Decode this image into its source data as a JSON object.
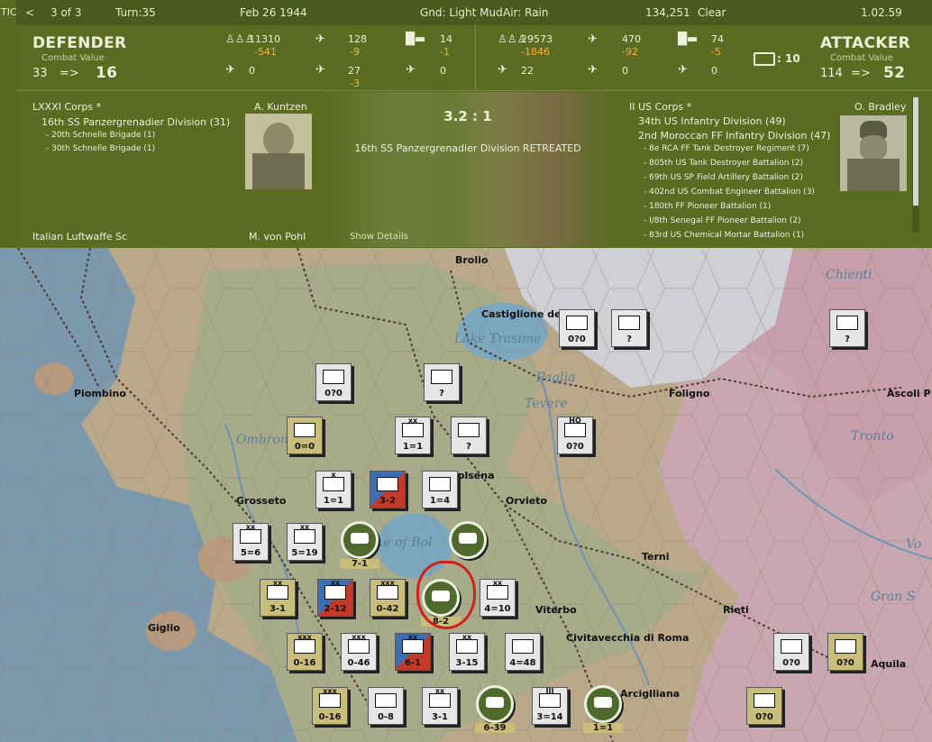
{
  "topbar": {
    "edge_label": "TIC",
    "back": "<",
    "page": "3 of 3",
    "turn": "Turn:35",
    "date": "Feb 26 1944",
    "ground": "Gnd: Light Mud",
    "air": "Air: Rain",
    "score": "134,251",
    "weather": "Clear",
    "version": "1.02.59"
  },
  "defender": {
    "title": "DEFENDER",
    "cv_label": "Combat Value",
    "cv_from": "33",
    "arrow": "=>",
    "cv_to": "16",
    "men": "11310",
    "men_loss": "-541",
    "planes1": "128",
    "planes1_loss": "-9",
    "tanks": "14",
    "tanks_loss": "-1",
    "planes2": "0",
    "planes3": "27",
    "planes3_loss": "-3",
    "planes4": "0"
  },
  "attacker": {
    "title": "ATTACKER",
    "cv_label": "Combat Value",
    "cv_from": "114",
    "arrow": "=>",
    "cv_to": "52",
    "men": "29573",
    "men_loss": "-1846",
    "planes1": "470",
    "planes1_loss": "-92",
    "tanks": "74",
    "tanks_loss": "-5",
    "planes2": "22",
    "planes3": "0",
    "planes4": "0",
    "rail": ": 10"
  },
  "def_units": {
    "corps": "LXXXI Corps *",
    "leader": "A. Kuntzen",
    "lines": [
      "16th SS Panzergrenadier Division (31)",
      "- 20th Schnelle Brigade (1)",
      "- 30th Schnelle Brigade (1)"
    ],
    "next_corps": "Italian Luftwaffe Sc",
    "next_leader": "M. von Pohl"
  },
  "result": {
    "odds": "3.2 : 1",
    "message": "16th SS Panzergrenadier Division RETREATED",
    "details": "Show Details"
  },
  "att_units": {
    "corps": "II US Corps *",
    "leader": "O. Bradley",
    "lines": [
      "34th US Infantry Division (49)",
      "2nd Moroccan FF Infantry Division (47)",
      "- 8e RCA FF Tank Destroyer Regiment (7)",
      "- 805th US Tank Destroyer Battalion (2)",
      "- 69th US SP Field Artillery Battalion (2)",
      "- 402nd US Combat Engineer Battalion (3)",
      "- 180th FF Pioneer Battalion (1)",
      "- I/8th Senegal FF Pioneer Battalion (2)",
      "- 83rd US Chemical Mortar Battalion (1)"
    ]
  },
  "map": {
    "cities": [
      {
        "name": "Brolio"
      },
      {
        "name": "Castiglione del"
      },
      {
        "name": "Piombino"
      },
      {
        "name": "Foligno"
      },
      {
        "name": "Ascoli P"
      },
      {
        "name": "Grosseto"
      },
      {
        "name": "Orvieto"
      },
      {
        "name": "Terni"
      },
      {
        "name": "Rieti"
      },
      {
        "name": "Giglio"
      },
      {
        "name": "Viterbo"
      },
      {
        "name": "Aquila"
      },
      {
        "name": "Civitavecchia di Roma"
      },
      {
        "name": "Arciglliana"
      },
      {
        "name": "Volsena"
      }
    ],
    "regions": [
      {
        "name": "Chienti"
      },
      {
        "name": "Lake Trasime"
      },
      {
        "name": "Paglia"
      },
      {
        "name": "Tevere"
      },
      {
        "name": "Ombrone"
      },
      {
        "name": "Tronto"
      },
      {
        "name": "ke of Bol"
      },
      {
        "name": "Gran S"
      },
      {
        "name": "Vo"
      }
    ],
    "units": [
      {
        "v": "0?0",
        "s": ""
      },
      {
        "v": "?",
        "s": ""
      },
      {
        "v": "?",
        "s": ""
      },
      {
        "v": "0?0",
        "s": ""
      },
      {
        "v": "?",
        "s": ""
      },
      {
        "v": "0=0",
        "s": ""
      },
      {
        "v": "1=1",
        "s": "xx"
      },
      {
        "v": "?",
        "s": ""
      },
      {
        "v": "0?0",
        "s": "HQ"
      },
      {
        "v": "1=1",
        "s": "x"
      },
      {
        "v": "3-2",
        "s": ""
      },
      {
        "v": "1=4",
        "s": ""
      },
      {
        "v": "5=6",
        "s": "xx"
      },
      {
        "v": "5=19",
        "s": "xx"
      },
      {
        "v": "7-1",
        "s": ""
      },
      {
        "v": "",
        "s": ""
      },
      {
        "v": "3-1",
        "s": "xx"
      },
      {
        "v": "2-12",
        "s": "xx"
      },
      {
        "v": "0-42",
        "s": "xxx"
      },
      {
        "v": "8-2",
        "s": ""
      },
      {
        "v": "4=10",
        "s": "xx"
      },
      {
        "v": "0-16",
        "s": "xxx"
      },
      {
        "v": "0-46",
        "s": "xxx"
      },
      {
        "v": "6-1",
        "s": "xx"
      },
      {
        "v": "3-15",
        "s": "xx"
      },
      {
        "v": "4=48",
        "s": ""
      },
      {
        "v": "0?0",
        "s": ""
      },
      {
        "v": "0?0",
        "s": ""
      },
      {
        "v": "0-16",
        "s": "xxx"
      },
      {
        "v": "0-8",
        "s": ""
      },
      {
        "v": "3-1",
        "s": "xx"
      },
      {
        "v": "6-39",
        "s": ""
      },
      {
        "v": "3=14",
        "s": "III"
      },
      {
        "v": "1=1",
        "s": ""
      },
      {
        "v": "0?0",
        "s": ""
      }
    ]
  }
}
